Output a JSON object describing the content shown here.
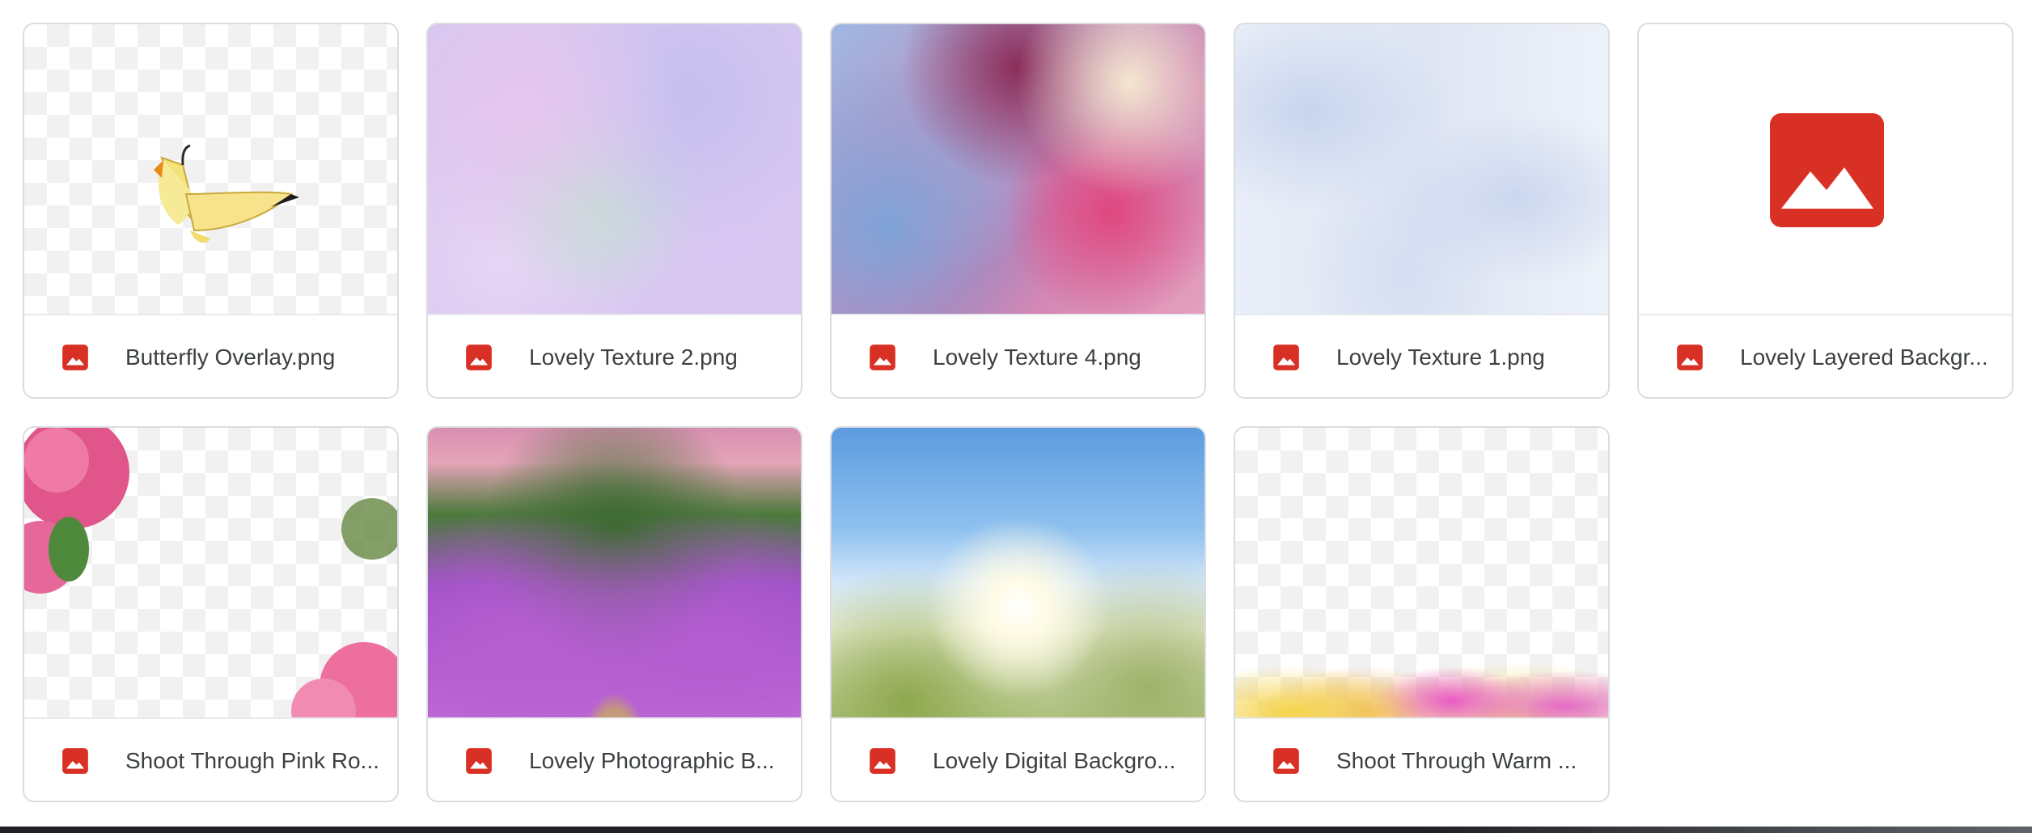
{
  "files": [
    {
      "name": "Butterfly Overlay.png",
      "thumbnail": "butterfly-overlay"
    },
    {
      "name": "Lovely Texture 2.png",
      "thumbnail": "pastel-texture"
    },
    {
      "name": "Lovely Texture 4.png",
      "thumbnail": "watercolor-texture"
    },
    {
      "name": "Lovely Texture 1.png",
      "thumbnail": "blue-white-texture"
    },
    {
      "name": "Lovely Layered Backgr...",
      "thumbnail": "generic-image-icon"
    },
    {
      "name": "Shoot Through Pink Ro...",
      "thumbnail": "pink-roses-overlay"
    },
    {
      "name": "Lovely Photographic B...",
      "thumbnail": "purple-flower-path"
    },
    {
      "name": "Lovely Digital Backgro...",
      "thumbnail": "sunny-meadow"
    },
    {
      "name": "Shoot Through Warm ...",
      "thumbnail": "warm-flowers-overlay"
    }
  ],
  "file_type_icon": "image-file-icon",
  "colors": {
    "file_icon": "#d93025",
    "border": "#dadce0",
    "text": "#3c4043"
  }
}
